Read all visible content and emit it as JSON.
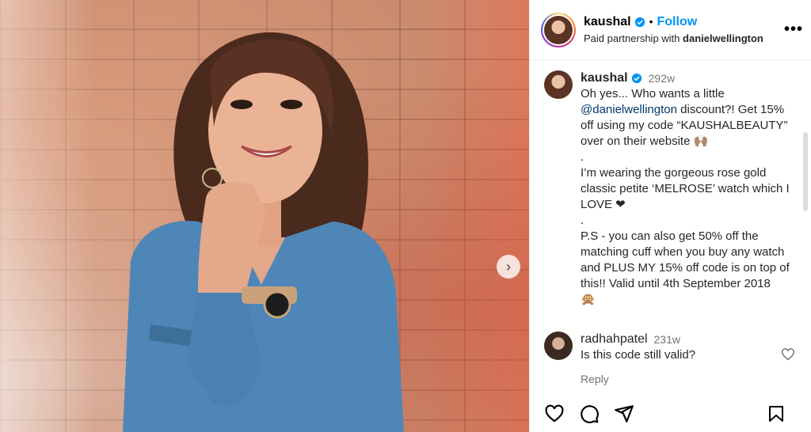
{
  "post": {
    "username": "kaushal",
    "follow_label": "Follow",
    "dot": "•",
    "partnership_prefix": "Paid partnership with",
    "partner": "danielwellington",
    "more_label": "•••"
  },
  "caption": {
    "username": "kaushal",
    "time": "292w",
    "line1": "Oh yes... Who wants a little",
    "mention": "@danielwellington",
    "line2": " discount?! Get 15% off using my code “KAUSHALBEAUTY” over on their website 🙌🏽",
    "sep1": ".",
    "para2": "I’m wearing the gorgeous rose gold classic petite ‘MELROSE’ watch which I LOVE ❤",
    "sep2": ".",
    "para3": "P.S - you can also get 50% off the matching cuff when you buy any watch and PLUS MY 15% off code is on top of this!! Valid until 4th September 2018",
    "emoji": "🙊"
  },
  "comment": {
    "username": "radhahpatel",
    "time": "231w",
    "text": "Is this code still valid?",
    "reply_label": "Reply"
  },
  "icons": {
    "verified": "verified-badge-icon",
    "like": "heart-icon",
    "comment": "comment-icon",
    "share": "share-icon",
    "save": "bookmark-icon",
    "next": "chevron-right-icon"
  },
  "colors": {
    "accent": "#0095f6",
    "mention": "#00376b",
    "muted": "#737373"
  }
}
